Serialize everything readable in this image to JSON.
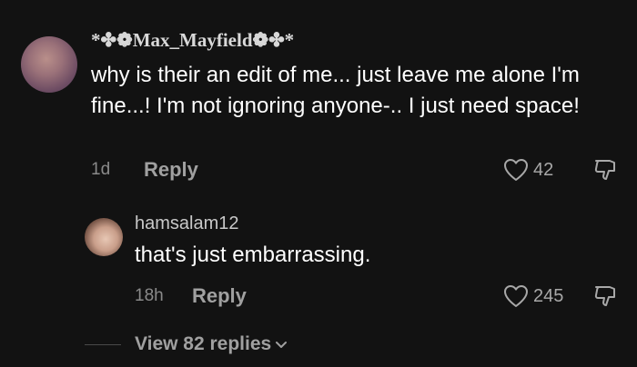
{
  "comments": [
    {
      "username": "*✤❁Max_Mayfield❁✤*",
      "text": "why is their an edit of me... just leave me alone I'm fine...! I'm not ignoring anyone-.. I just need space!",
      "time": "1d",
      "reply_label": "Reply",
      "likes": "42"
    },
    {
      "username": "hamsalam12",
      "text": "that's just embarrassing.",
      "time": "18h",
      "reply_label": "Reply",
      "likes": "245"
    }
  ],
  "view_replies_label": "View 82 replies",
  "icons": {
    "like": "heart-outline-icon",
    "dislike": "thumbs-down-outline-icon",
    "expand": "chevron-down-icon"
  },
  "colors": {
    "background": "#121212",
    "text_primary": "#ffffff",
    "text_secondary": "#a0a0a0",
    "text_muted": "#8a8a8a"
  }
}
